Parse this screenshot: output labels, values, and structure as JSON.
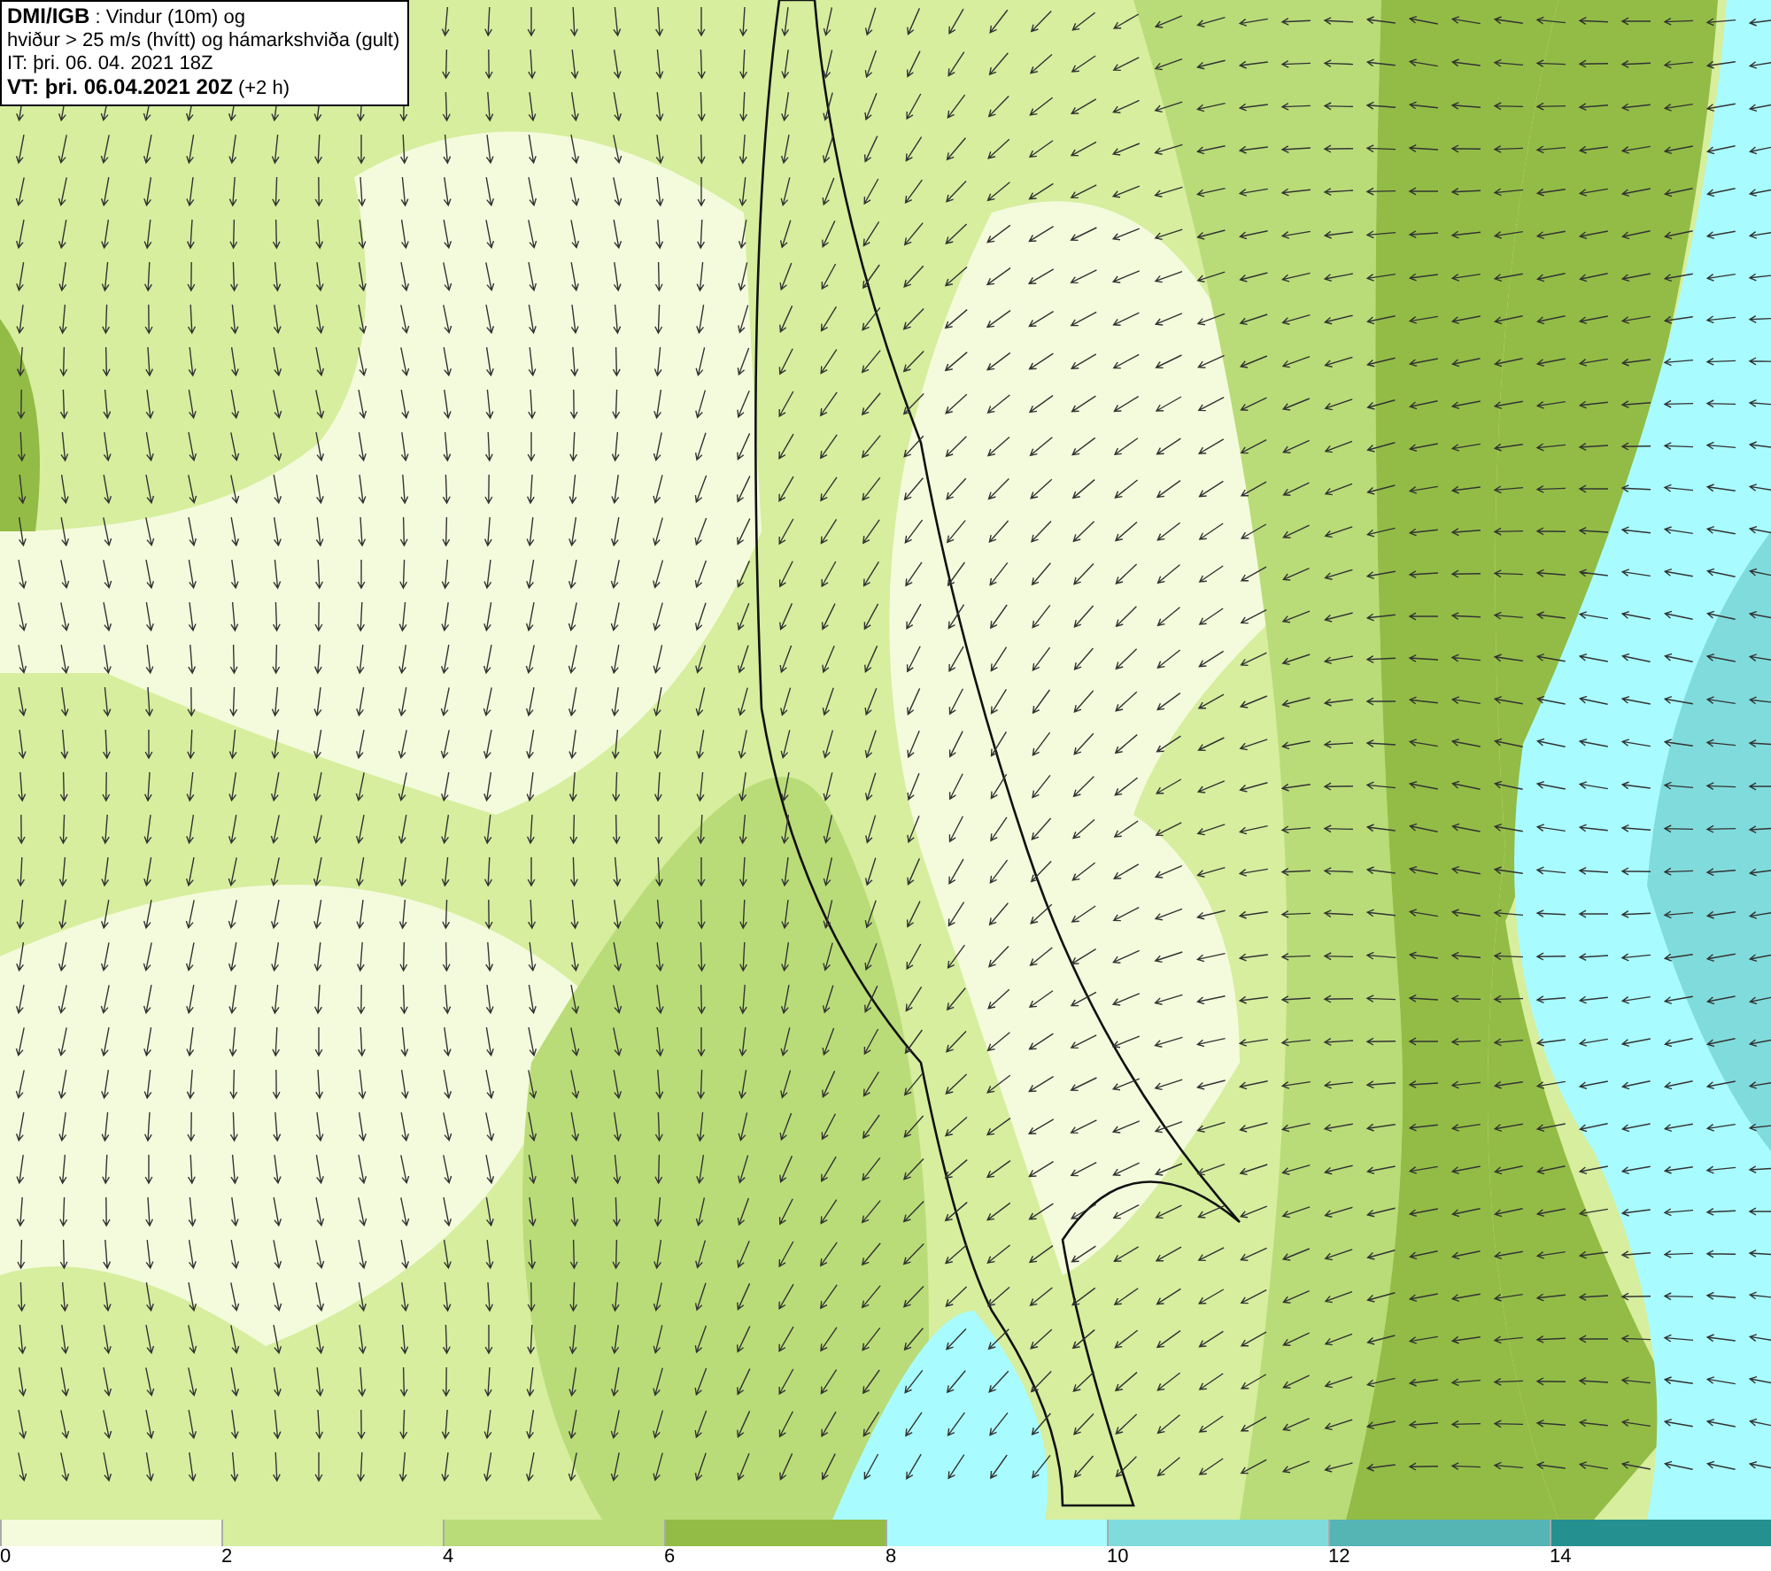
{
  "title_box": {
    "lines": [
      "**DMI/IGB** : Vindur (10m) og",
      "hviður > 25 m/s (hvítt) og hámarkshviða (gult)",
      "IT: þri. 06. 04. 2021 18Z",
      "**VT: þri. 06.04.2021 20Z** (+2 h)"
    ]
  },
  "legend": [
    {
      "label": "0",
      "color": "#f4fbdc"
    },
    {
      "label": "2",
      "color": "#d6ee9e"
    },
    {
      "label": "4",
      "color": "#b9dc78"
    },
    {
      "label": "6",
      "color": "#93bc46"
    },
    {
      "label": "8",
      "color": "#a8fcff"
    },
    {
      "label": "10",
      "color": "#80dcdc"
    },
    {
      "label": "12",
      "color": "#55b4b4"
    },
    {
      "label": "14",
      "color": "#259090"
    }
  ]
}
